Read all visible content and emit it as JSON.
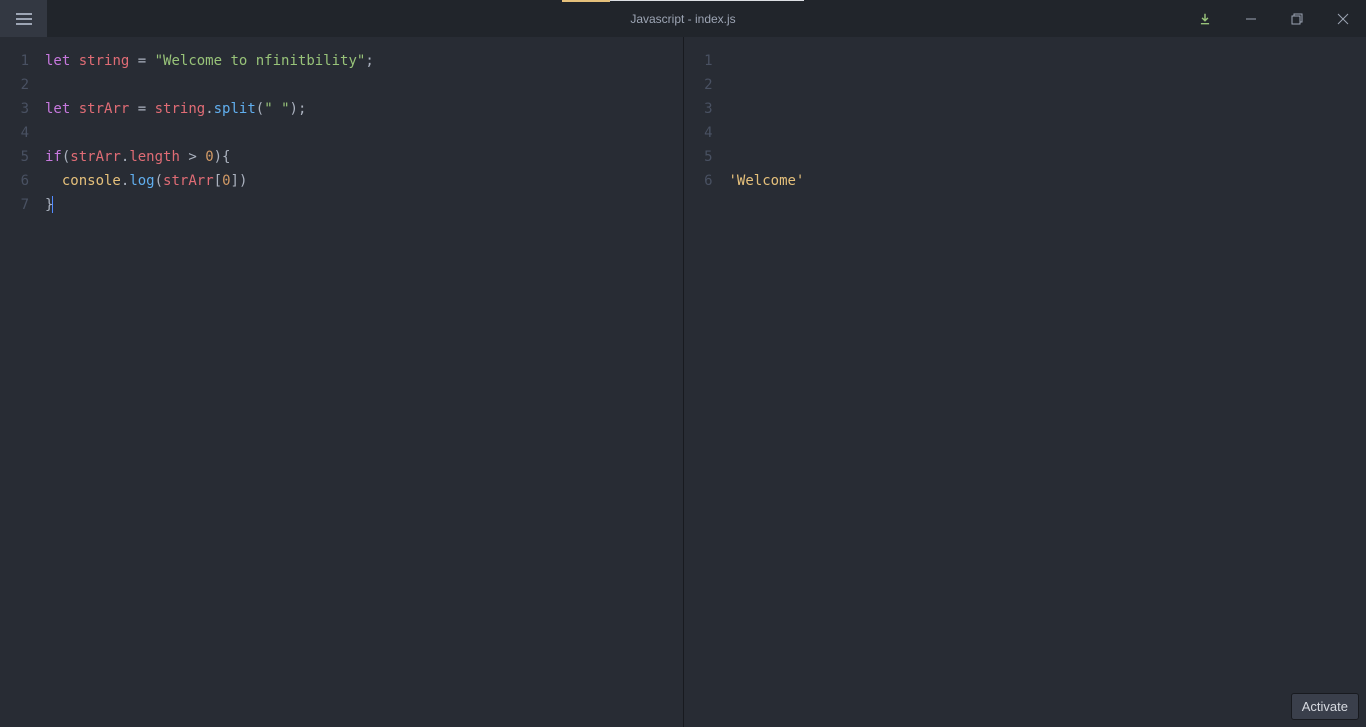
{
  "titlebar": {
    "title": "Javascript - index.js"
  },
  "editor": {
    "lines": [
      1,
      2,
      3,
      4,
      5,
      6,
      7
    ],
    "code": {
      "l1_let": "let",
      "l1_var": "string",
      "l1_eq": " = ",
      "l1_str": "\"Welcome to nfinitbility\"",
      "l1_semi": ";",
      "l3_let": "let",
      "l3_var": "strArr",
      "l3_eq": " = ",
      "l3_obj": "string",
      "l3_dot": ".",
      "l3_fn": "split",
      "l3_open": "(",
      "l3_arg": "\" \"",
      "l3_close": ");",
      "l5_if": "if",
      "l5_open": "(",
      "l5_obj": "strArr",
      "l5_dot": ".",
      "l5_prop": "length",
      "l5_op": " > ",
      "l5_num": "0",
      "l5_close": "){",
      "l6_indent": "  ",
      "l6_console": "console",
      "l6_dot": ".",
      "l6_log": "log",
      "l6_open": "(",
      "l6_arr": "strArr",
      "l6_bopen": "[",
      "l6_idx": "0",
      "l6_bclose": "]",
      "l6_close": ")",
      "l7_brace": "}"
    }
  },
  "output": {
    "lines": [
      1,
      2,
      3,
      4,
      5,
      6
    ],
    "value": "'Welcome'"
  },
  "activate_label": "Activate"
}
